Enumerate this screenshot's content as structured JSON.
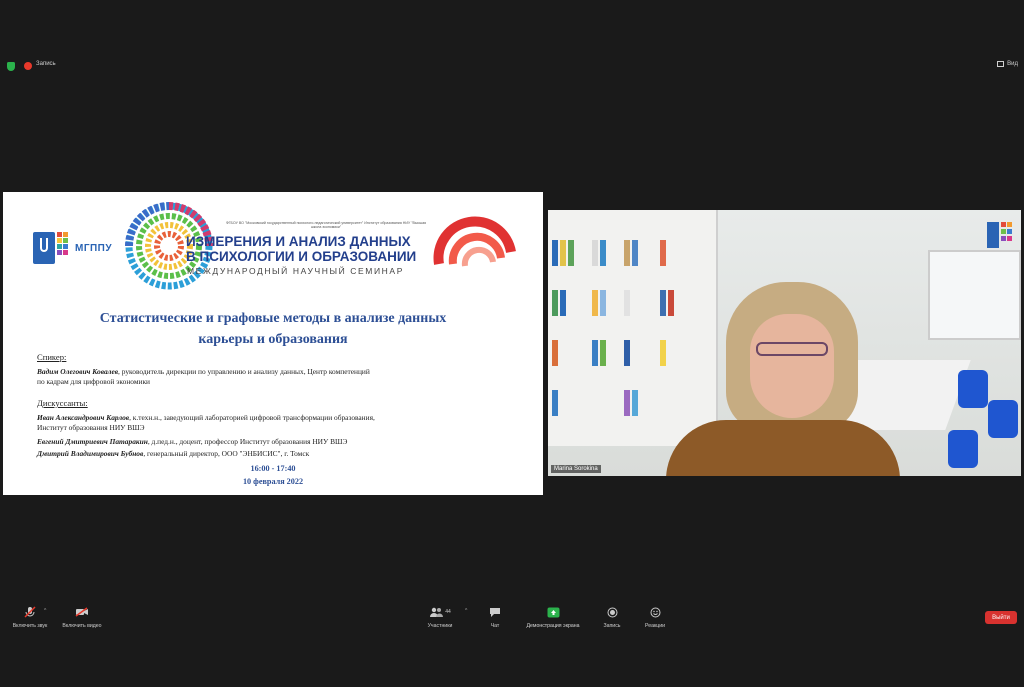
{
  "topbar": {
    "recording_label": "Запись",
    "view_label": "Вид"
  },
  "slide": {
    "mgppu_logo_text": "МГППУ",
    "org_line": "ФГБОУ ВО \"Московский государственный психолого-педагогический университет\" Институт образования НИУ \"Высшая школа экономики\"",
    "conference_title_line1": "ИЗМЕРЕНИЯ И АНАЛИЗ ДАННЫХ",
    "conference_title_line2": "В ПСИХОЛОГИИ И ОБРАЗОВАНИИ",
    "conference_subtitle": "МЕЖДУНАРОДНЫЙ НАУЧНЫЙ СЕМИНАР",
    "talk_title_line1": "Статистические и графовые методы в анализе данных",
    "talk_title_line2": "карьеры и образования",
    "speaker_label": "Спикер:",
    "speaker_name": "Вадим Олегович Ковалев",
    "speaker_desc_line1": ", руководитель дирекции по управлению и анализу данных, Центр компетенций",
    "speaker_desc_line2": "по кадрам для цифровой экономики",
    "discussants_label": "Дискуссанты:",
    "d1_name": "Иван Александрович Карлов",
    "d1_desc_line1": ", к.техн.н., заведующий лабораторией цифровой трансформации образования,",
    "d1_desc_line2": "Институт образования НИУ ВШЭ",
    "d2_name": "Евгений Дмитриевич Патаракин",
    "d2_desc": ", д.пед.н., доцент, профессор Институт образования НИУ ВШЭ",
    "d3_name": "Дмитрий Владимирович Бубнов",
    "d3_desc": ", генеральный директор, ООО \"ЭНБИСИС\", г. Томск",
    "time": "16:00 - 17:40",
    "date": "10 февраля 2022"
  },
  "video": {
    "participant_name": "Marina Sorokina"
  },
  "toolbar": {
    "unmute_label": "Включить звук",
    "start_video_label": "Включить видео",
    "participants_label": "Участники",
    "participants_count": "44",
    "chat_label": "Чат",
    "share_label": "Демонстрация экрана",
    "record_label": "Запись",
    "reactions_label": "Реакции",
    "leave_label": "Выйти"
  },
  "colors": {
    "accent_green": "#2bb24c",
    "leave_red": "#d8322f",
    "slide_blue": "#2d4f95"
  }
}
